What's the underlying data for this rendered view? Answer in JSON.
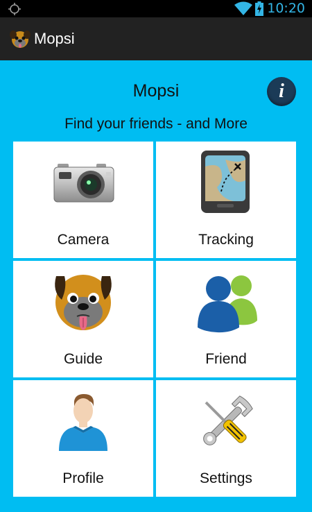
{
  "status_bar": {
    "time": "10:20",
    "icons": [
      "gps-icon",
      "wifi-icon",
      "battery-charging-icon"
    ]
  },
  "action_bar": {
    "title": "Mopsi",
    "icon": "pug-logo-icon"
  },
  "header": {
    "title": "Mopsi",
    "info_icon": "info-icon",
    "subtitle": "Find your friends - and More"
  },
  "tiles": [
    {
      "label": "Camera",
      "icon": "camera-icon"
    },
    {
      "label": "Tracking",
      "icon": "tracking-map-icon"
    },
    {
      "label": "Guide",
      "icon": "pug-face-icon"
    },
    {
      "label": "Friend",
      "icon": "friends-icon"
    },
    {
      "label": "Profile",
      "icon": "user-profile-icon"
    },
    {
      "label": "Settings",
      "icon": "wrench-screwdriver-icon"
    }
  ],
  "colors": {
    "background": "#00BDF2",
    "action_bar": "#222222",
    "status_time": "#33B5E5",
    "info_button": "#1b3b57"
  }
}
